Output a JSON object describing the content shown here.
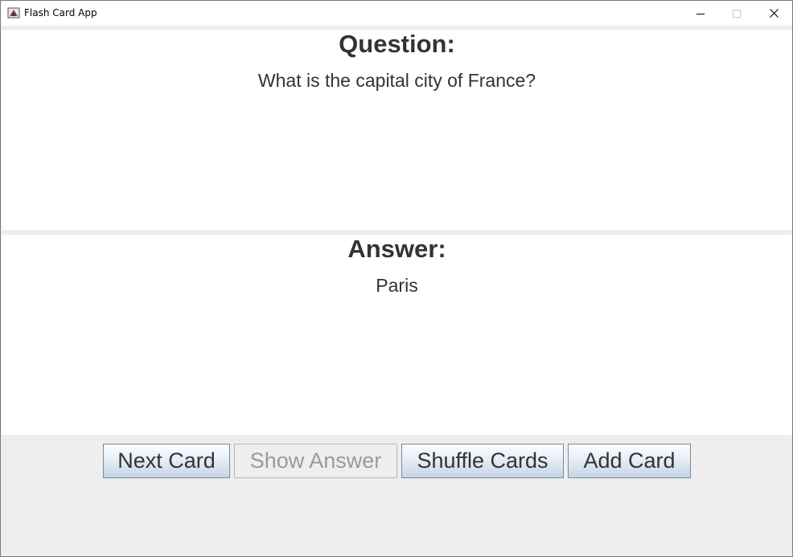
{
  "window": {
    "title": "Flash Card App"
  },
  "question": {
    "heading": "Question:",
    "text": "What is the capital city of France?"
  },
  "answer": {
    "heading": "Answer:",
    "text": "Paris"
  },
  "buttons": {
    "next_card": "Next Card",
    "show_answer": "Show Answer",
    "shuffle_cards": "Shuffle Cards",
    "add_card": "Add Card",
    "show_answer_enabled": false
  },
  "icons": {
    "app": "java-app-icon",
    "minimize": "minimize-icon",
    "maximize": "maximize-icon",
    "close": "close-icon"
  },
  "colors": {
    "button_gradient_top": "#fdfeff",
    "button_gradient_bottom": "#c4d4e6",
    "text": "#333333",
    "background": "#eeeeee"
  }
}
